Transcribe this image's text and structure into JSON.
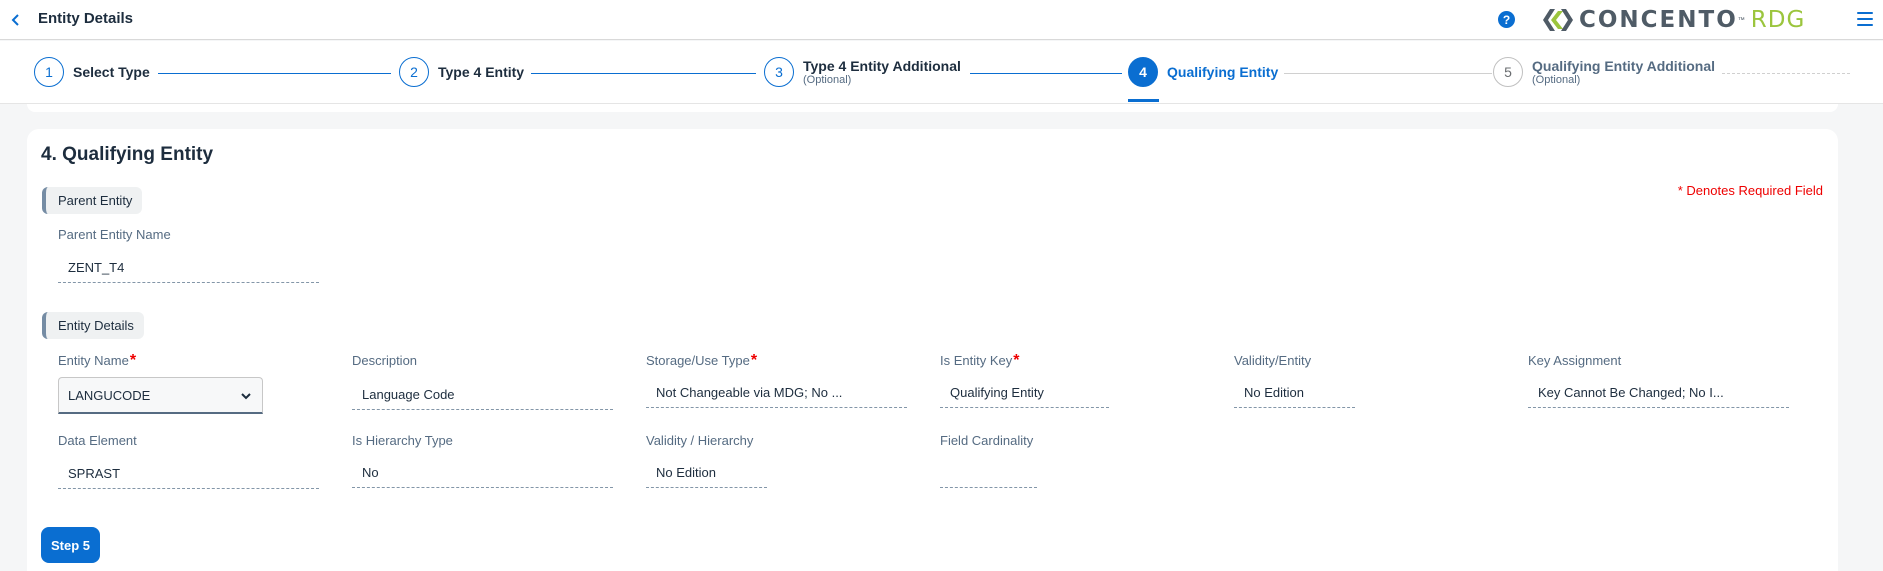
{
  "header": {
    "title": "Entity Details",
    "help_icon": "?",
    "logo_text": "CONCENTO",
    "logo_tm": "™",
    "logo_suffix": "RDG"
  },
  "stepper": {
    "steps": [
      {
        "number": "1",
        "label": "Select Type",
        "sublabel": "",
        "state": "completed"
      },
      {
        "number": "2",
        "label": "Type 4 Entity",
        "sublabel": "",
        "state": "completed"
      },
      {
        "number": "3",
        "label": "Type 4 Entity Additional",
        "sublabel": "(Optional)",
        "state": "completed"
      },
      {
        "number": "4",
        "label": "Qualifying Entity",
        "sublabel": "",
        "state": "active"
      },
      {
        "number": "5",
        "label": "Qualifying Entity Additional",
        "sublabel": "(Optional)",
        "state": "future"
      }
    ]
  },
  "form": {
    "section_title": "4. Qualifying Entity",
    "required_note": "* Denotes Required Field",
    "parent_group": "Parent Entity",
    "parent_entity_name": {
      "label": "Parent Entity Name",
      "value": "ZENT_T4"
    },
    "entity_group": "Entity Details",
    "fields": {
      "entity_name": {
        "label": "Entity Name",
        "value": "LANGUCODE",
        "required": "*"
      },
      "description": {
        "label": "Description",
        "value": "Language Code"
      },
      "storage_use_type": {
        "label": "Storage/Use Type",
        "value": "Not Changeable via MDG; No ...",
        "required": "*"
      },
      "is_entity_key": {
        "label": "Is Entity Key",
        "value": "Qualifying Entity",
        "required": "*"
      },
      "validity_entity": {
        "label": "Validity/Entity",
        "value": "No Edition"
      },
      "key_assignment": {
        "label": "Key Assignment",
        "value": "Key Cannot Be Changed; No I..."
      },
      "data_element": {
        "label": "Data Element",
        "value": "SPRAST"
      },
      "is_hierarchy_type": {
        "label": "Is Hierarchy Type",
        "value": "No"
      },
      "validity_hierarchy": {
        "label": "Validity / Hierarchy",
        "value": "No Edition"
      },
      "field_cardinality": {
        "label": "Field Cardinality",
        "value": ""
      }
    },
    "next_button": "Step 5"
  },
  "colors": {
    "accent": "#0a6ed1",
    "required": "#e00000",
    "logo_gray": "#4f5b66",
    "logo_green": "#9bc53d"
  }
}
